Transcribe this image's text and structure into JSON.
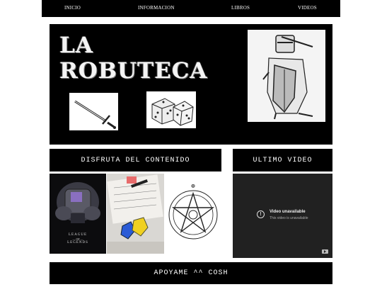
{
  "nav": {
    "items": [
      "INICIO",
      "INFORMACION",
      "LIBROS",
      "VIDEOS"
    ]
  },
  "hero": {
    "title_line1": "LA",
    "title_line2": "ROBUTECA",
    "images": [
      "sword-sketch",
      "dice-sketch",
      "knight-sketch"
    ]
  },
  "sections": {
    "content_header": "DISFRUTA DEL CONTENIDO",
    "video_header": "ULTIMO VIDEO"
  },
  "content_images": {
    "league": "LEAGUE",
    "of": "— OF —",
    "legends": "LEGENDS",
    "others": [
      "tabletop-dice-photo",
      "pentagram-seal"
    ]
  },
  "video": {
    "title": "Video unavailable",
    "subtitle": "This video is unavailable"
  },
  "footer": {
    "label": "APOYAME ^^ COSH"
  },
  "colors": {
    "panel": "#000000",
    "background": "#ffffff",
    "video_bg": "#212121"
  }
}
